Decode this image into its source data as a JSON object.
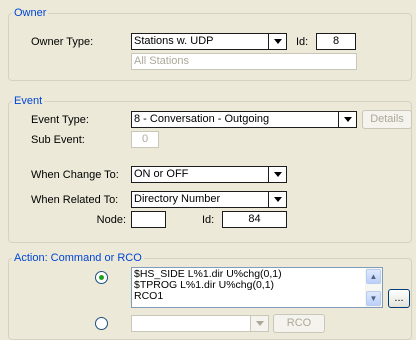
{
  "owner": {
    "section_title": "Owner",
    "owner_type_label": "Owner Type:",
    "owner_type_value": "Stations w. UDP",
    "id_label": "Id:",
    "id_value": "8",
    "description_value": "All Stations"
  },
  "event": {
    "section_title": "Event",
    "event_type_label": "Event Type:",
    "event_type_value": "8 - Conversation - Outgoing",
    "details_label": "Details",
    "sub_event_label": "Sub Event:",
    "sub_event_value": "0",
    "when_change_label": "When Change To:",
    "when_change_value": "ON or OFF",
    "when_related_label": "When Related To:",
    "when_related_value": "Directory Number",
    "node_label": "Node:",
    "node_value": "",
    "id_label": "Id:",
    "id_value": "84"
  },
  "action": {
    "section_title": "Action: Command or RCO",
    "command_lines": [
      "$HS_SIDE L%1.dir U%chg(0,1)",
      "$TPROG L%1.dir U%chg(0,1)",
      "RCO1"
    ],
    "ellipsis_label": "...",
    "rco_value": "",
    "rco_button_label": "RCO"
  },
  "icons": {
    "scroll_up": "scroll-up-arrow-icon",
    "scroll_down": "scroll-down-arrow-icon",
    "dropdown": "dropdown-arrow-icon"
  }
}
